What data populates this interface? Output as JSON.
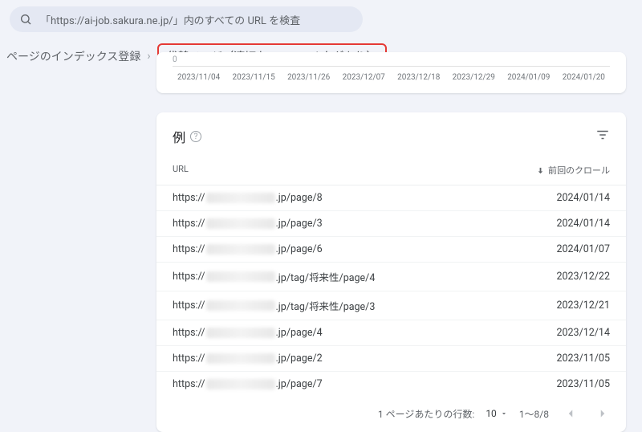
{
  "search": {
    "placeholder": "「https://ai-job.sakura.ne.jp/」内のすべての URL を検査"
  },
  "breadcrumb": {
    "parent": "ページのインデックス登録",
    "current": "代替ページ（適切な canonical タグあり）"
  },
  "chart": {
    "y_zero": "0",
    "x_ticks": [
      "2023/11/04",
      "2023/11/15",
      "2023/11/26",
      "2023/12/07",
      "2023/12/18",
      "2023/12/29",
      "2024/01/09",
      "2024/01/20"
    ]
  },
  "table": {
    "title": "例",
    "col_url": "URL",
    "col_date": "前回のクロール",
    "rows": [
      {
        "prefix": "https://",
        "suffix": ".jp/page/8",
        "date": "2024/01/14"
      },
      {
        "prefix": "https://",
        "suffix": ".jp/page/3",
        "date": "2024/01/14"
      },
      {
        "prefix": "https://",
        "suffix": ".jp/page/6",
        "date": "2024/01/07"
      },
      {
        "prefix": "https://",
        "suffix": ".jp/tag/将来性/page/4",
        "date": "2023/12/22"
      },
      {
        "prefix": "https://",
        "suffix": ".jp/tag/将来性/page/3",
        "date": "2023/12/21"
      },
      {
        "prefix": "https://",
        "suffix": ".jp/page/4",
        "date": "2023/12/14"
      },
      {
        "prefix": "https://",
        "suffix": ".jp/page/2",
        "date": "2023/11/05"
      },
      {
        "prefix": "https://",
        "suffix": ".jp/page/7",
        "date": "2023/11/05"
      }
    ],
    "pager": {
      "rows_label": "1 ページあたりの行数:",
      "rows_value": "10",
      "range": "1～8/8"
    }
  }
}
